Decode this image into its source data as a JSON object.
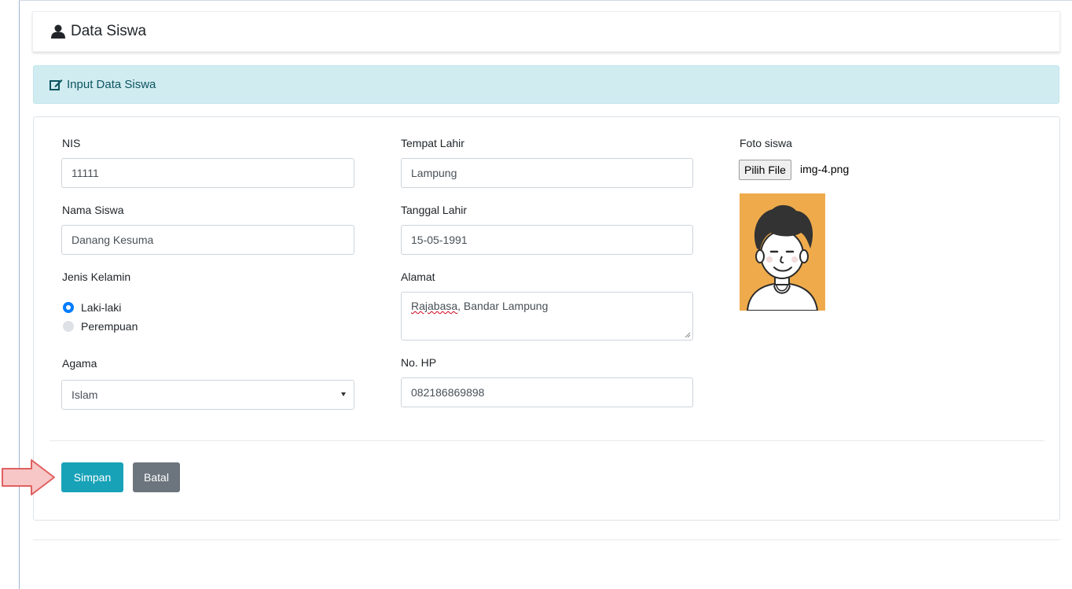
{
  "page": {
    "title": "Data Siswa"
  },
  "alert": {
    "text": "Input Data Siswa"
  },
  "form": {
    "nis": {
      "label": "NIS",
      "value": "11111"
    },
    "nama": {
      "label": "Nama Siswa",
      "value": "Danang Kesuma"
    },
    "jenis_kelamin": {
      "label": "Jenis Kelamin",
      "options": [
        {
          "label": "Laki-laki",
          "selected": true
        },
        {
          "label": "Perempuan",
          "selected": false
        }
      ]
    },
    "agama": {
      "label": "Agama",
      "value": "Islam"
    },
    "tempat_lahir": {
      "label": "Tempat Lahir",
      "value": "Lampung"
    },
    "tanggal_lahir": {
      "label": "Tanggal Lahir",
      "value": "15-05-1991"
    },
    "alamat": {
      "label": "Alamat",
      "value_part1": "Rajabasa",
      "value_part2": ", Bandar Lampung"
    },
    "no_hp": {
      "label": "No. HP",
      "value": "082186869898"
    },
    "foto": {
      "label": "Foto siswa",
      "button_label": "Pilih File",
      "file_name": "img-4.png"
    }
  },
  "buttons": {
    "save_label": "Simpan",
    "cancel_label": "Batal"
  },
  "colors": {
    "primary": "#17a2b8",
    "secondary": "#6c757d",
    "alert_bg": "#d1ecf1",
    "radio_checked": "#007bff",
    "photo_bg": "#efab4b",
    "arrow_fill": "#f7c6c6",
    "arrow_stroke": "#e06060"
  },
  "icons": {
    "title_icon": "user-icon",
    "alert_icon": "edit-icon",
    "photo": "avatar-illustration",
    "pointer": "arrow-right-icon"
  }
}
